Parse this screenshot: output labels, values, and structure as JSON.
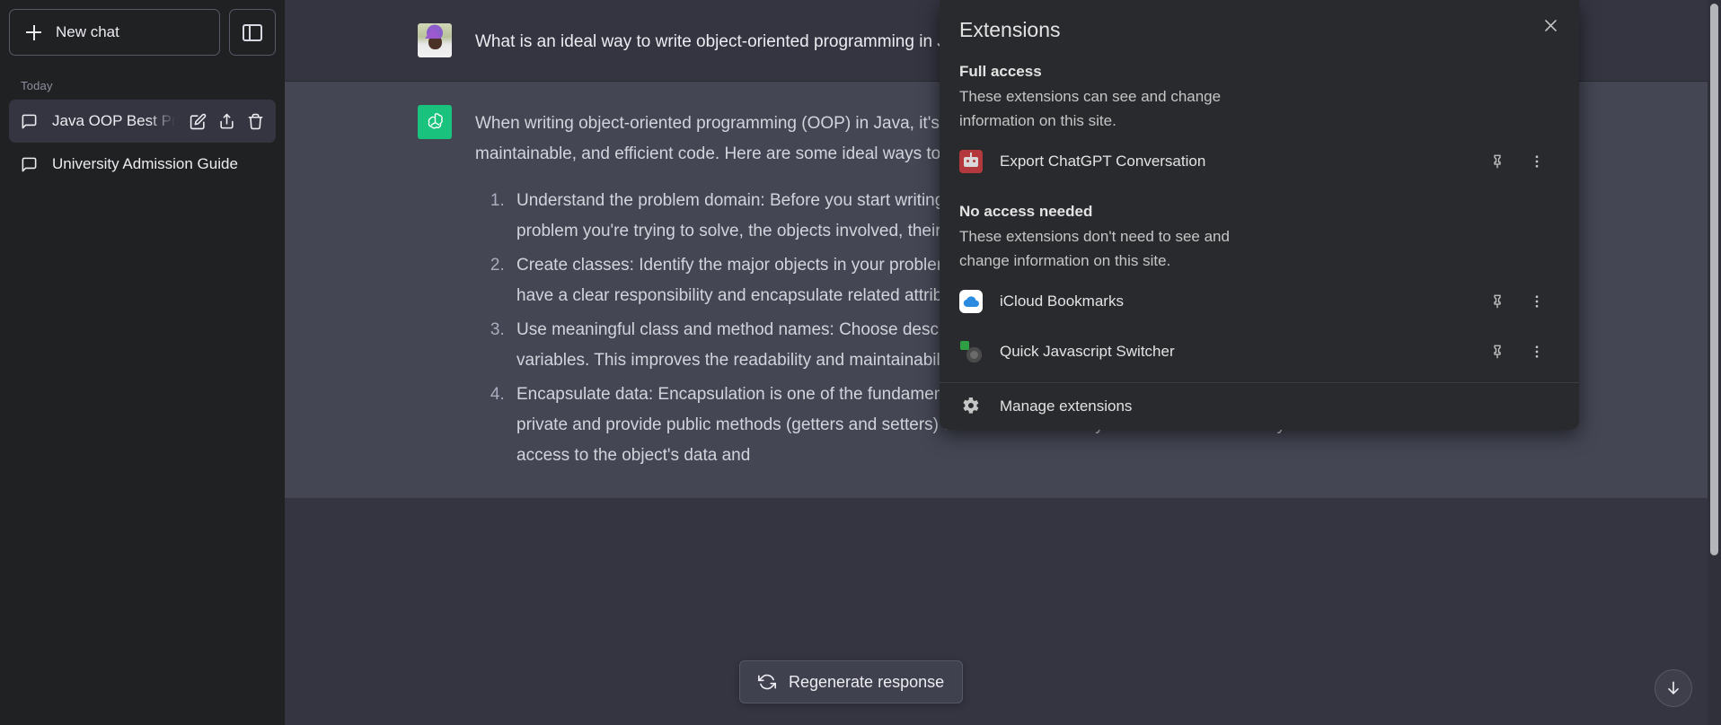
{
  "sidebar": {
    "new_chat_label": "New chat",
    "section_label": "Today",
    "chats": [
      {
        "title": "Java OOP Best Practices",
        "active": true
      },
      {
        "title": "University Admission Guide",
        "active": false
      }
    ]
  },
  "conversation": {
    "user_message": "What is an ideal way to write object-oriented programming in Java?",
    "assistant_intro_p1": "When writing object-oriented programming (OOP) in Java, it's important to follow best practices to ensure clean, maintainable, and efficient code. Here are some ideal ways to write OOP in Java:",
    "assistant_steps": [
      "Understand the problem domain: Before you start writing any code, make sure you have a clear understanding of the problem you're trying to solve, the objects involved, their attributes, and their behaviors.",
      "Create classes: Identify the major objects in your problem domain and create a class for each one. Classes should have a clear responsibility and encapsulate related attributes and behaviors.",
      "Use meaningful class and method names: Choose descriptive and meaningful names for classes, methods, and variables. This improves the readability and maintainability of your code.",
      "Encapsulate data: Encapsulation is one of the fundamental principles of OOP. Keep the internal state of your objects private and provide public methods (getters and setters) to access and modify that state. This allows you to control access to the object's data and"
    ],
    "regenerate_label": "Regenerate response"
  },
  "extensions_popup": {
    "title": "Extensions",
    "close_label": "Close",
    "groups": [
      {
        "title": "Full access",
        "description": "These extensions can see and change information on this site.",
        "items": [
          {
            "name": "Export ChatGPT Conversation",
            "icon": "robot-icon"
          }
        ]
      },
      {
        "title": "No access needed",
        "description": "These extensions don't need to see and change information on this site.",
        "items": [
          {
            "name": "iCloud Bookmarks",
            "icon": "icloud-icon"
          },
          {
            "name": "Quick Javascript Switcher",
            "icon": "qjs-icon"
          }
        ]
      }
    ],
    "manage_label": "Manage extensions"
  },
  "colors": {
    "sidebar_bg": "#202123",
    "main_bg": "#343541",
    "assistant_bg": "#444654",
    "popup_bg": "#292a2d",
    "accent_green": "#19c37d",
    "robot_red": "#b4393c",
    "icloud_blue": "#2a8ae0"
  }
}
